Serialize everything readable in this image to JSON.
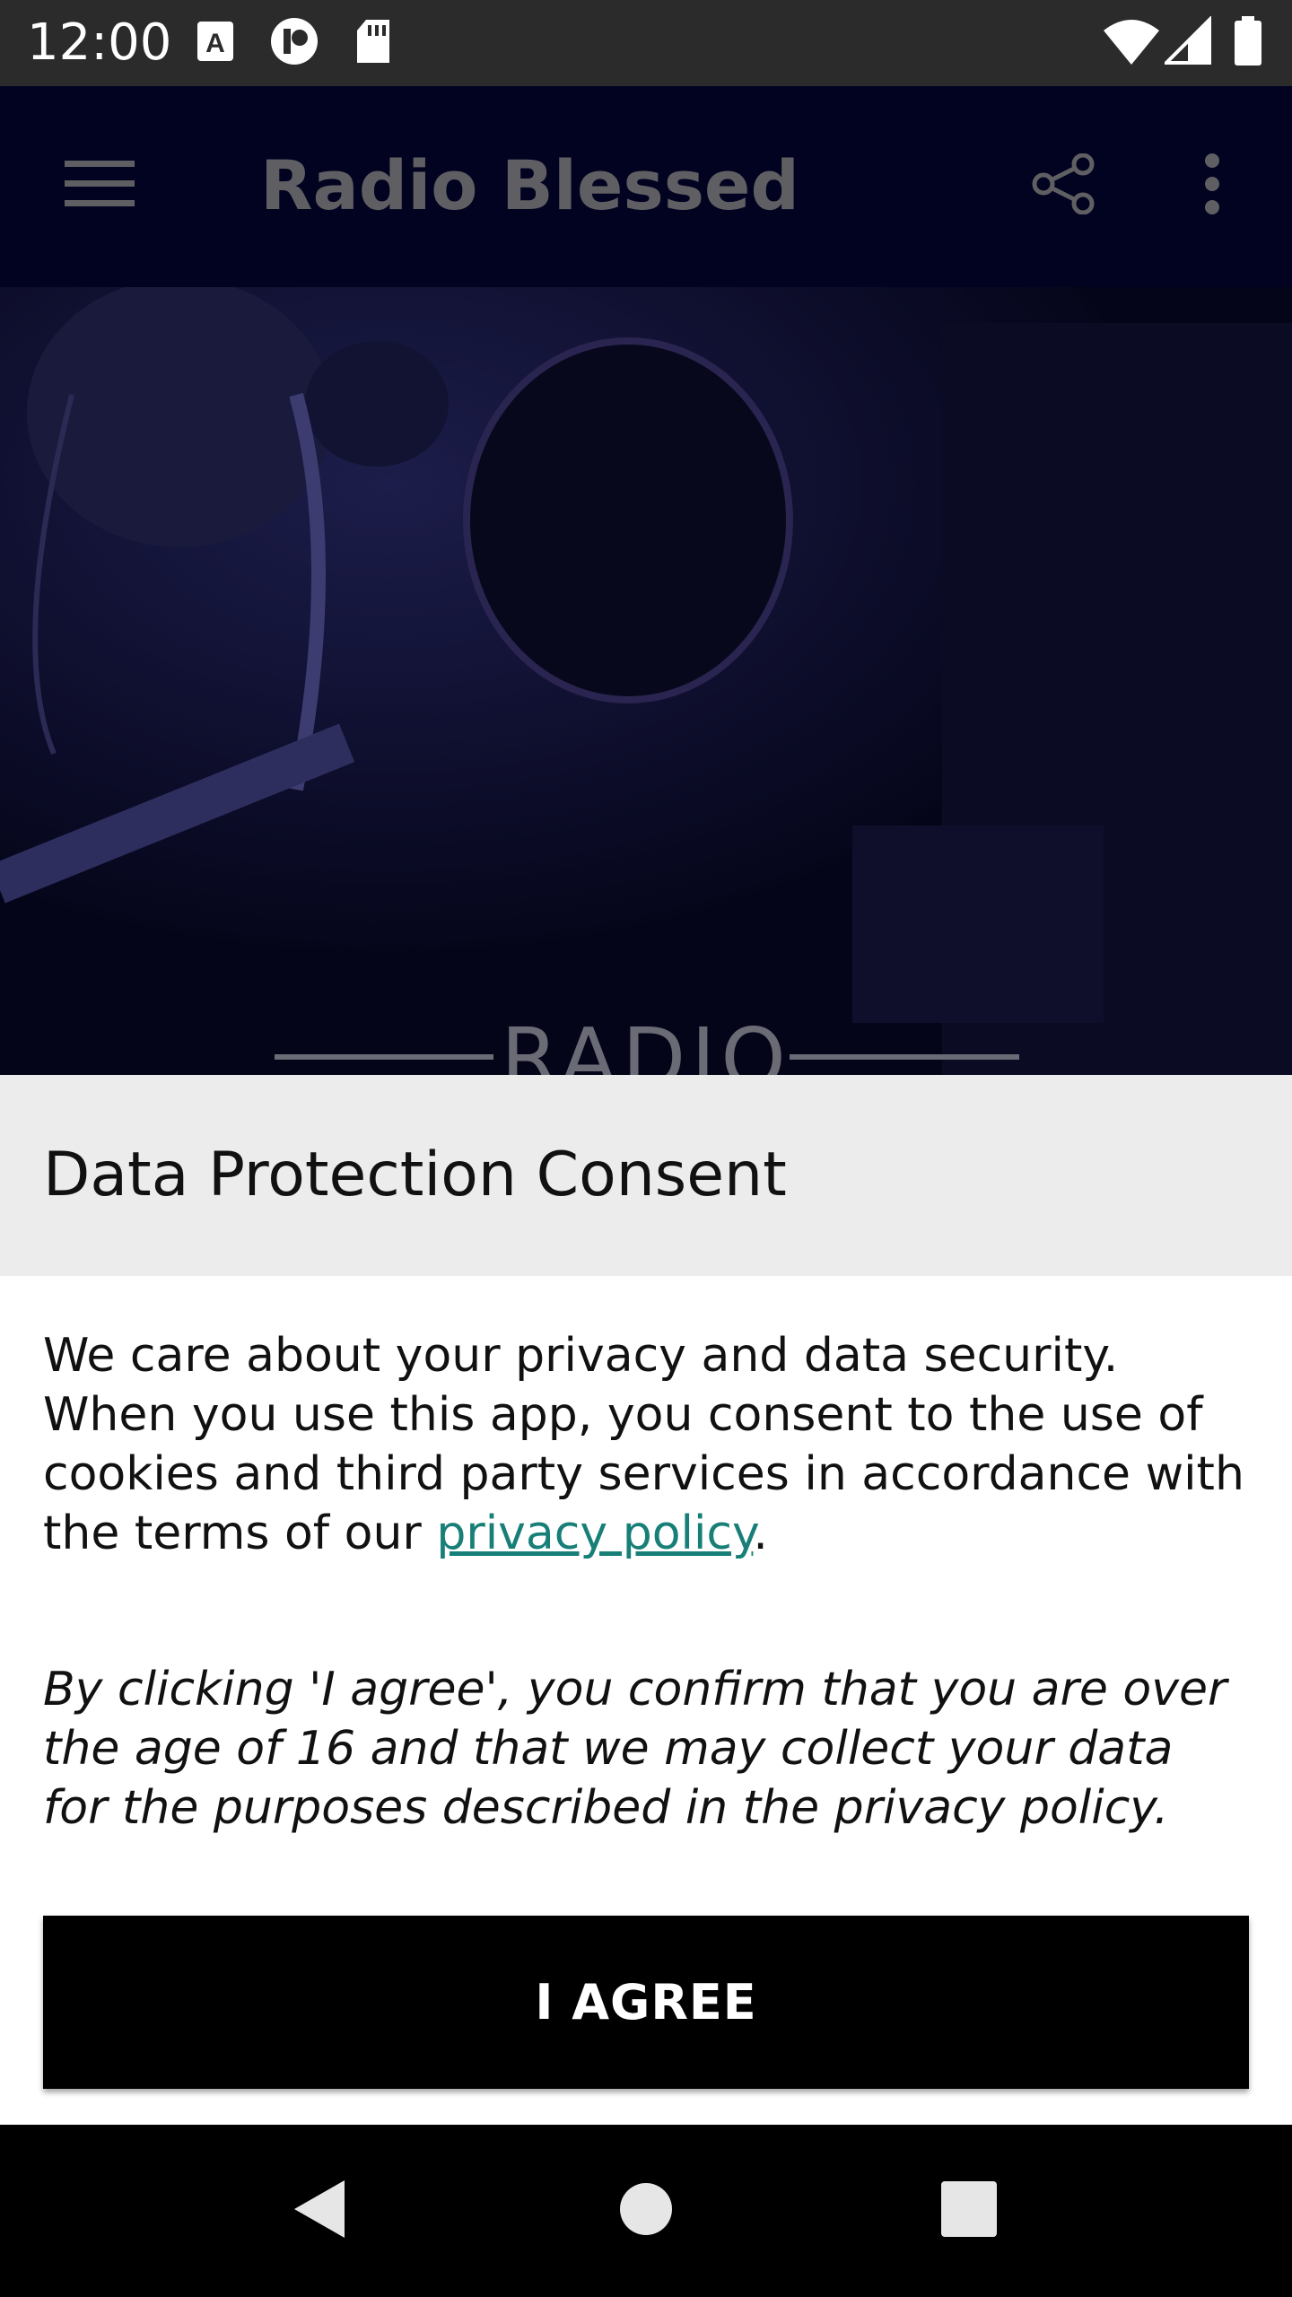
{
  "status_bar": {
    "time": "12:00",
    "left_icons": [
      "font-a-icon",
      "notification-p-icon",
      "sd-card-icon"
    ],
    "right_icons": [
      "wifi-icon",
      "cell-signal-icon",
      "battery-icon"
    ]
  },
  "app_bar": {
    "title": "Radio Blessed",
    "icons": [
      "menu-icon",
      "share-icon",
      "more-vert-icon"
    ]
  },
  "hero": {
    "label": "RADIO"
  },
  "consent": {
    "title": "Data Protection Consent",
    "paragraph1_text": "We care about your privacy and data security. When you use this app, you consent to the use of cookies and third party services in accordance with the terms of our ",
    "paragraph1_link": "privacy policy",
    "paragraph1_end": ".",
    "paragraph2": "By clicking 'I agree', you confirm that you are over the age of 16 and that we may collect your data for the purposes described in the privacy policy.",
    "agree_button": "I AGREE"
  },
  "nav_bar": {
    "icons": [
      "back-icon",
      "home-icon",
      "recents-icon"
    ]
  },
  "colors": {
    "status_bar": "#2b2b2b",
    "app_bar": "#020321",
    "link": "#177f78",
    "button": "#000000",
    "sheet_header": "#ececec"
  }
}
